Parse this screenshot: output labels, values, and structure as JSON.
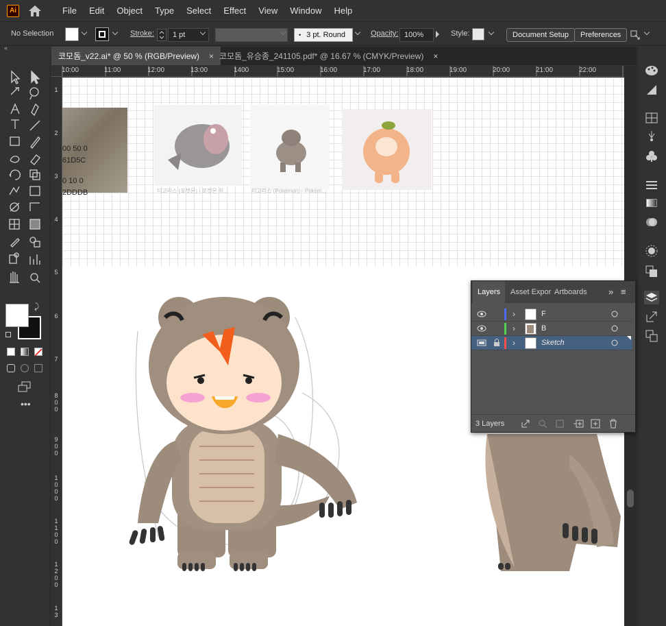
{
  "app": {
    "logo": "Ai",
    "menu": [
      "File",
      "Edit",
      "Object",
      "Type",
      "Select",
      "Effect",
      "View",
      "Window",
      "Help"
    ]
  },
  "control_bar": {
    "selection": "No Selection",
    "stroke_label": "Stroke:",
    "stroke_value": "1 pt",
    "brush_value": "3 pt. Round",
    "opacity_label": "Opacity:",
    "opacity_value": "100%",
    "style_label": "Style:",
    "document_setup": "Document Setup",
    "preferences": "Preferences"
  },
  "tabs": [
    {
      "label": "코모돔_v22.ai* @ 50 % (RGB/Preview)",
      "close": "×"
    },
    {
      "label": "코모돔_유승종_241105.pdf* @ 16.67 % (CMYK/Preview)",
      "close": "×"
    }
  ],
  "ruler": {
    "h": [
      "10:00",
      "11:00",
      "12:00",
      "13:00",
      "1400",
      "15:00",
      "16:00",
      "17:00",
      "18:00",
      "19:00",
      "20:00",
      "21:00",
      "22:00"
    ],
    "v": [
      "1",
      "2",
      "3",
      "4",
      "5",
      "6",
      "7",
      "8\n0\n0",
      "9\n0\n0",
      "1\n0\n0\n0",
      "1\n1\n0\n0",
      "1\n2\n0\n0",
      "1\n3"
    ]
  },
  "canvas": {
    "color_note_1": "00 50 0",
    "color_note_2": "61D5C",
    "color_note_3": "0 10 0",
    "color_note_4": "2DDDB",
    "caption_1": "티고리스 (포켓몬) | 포켓몬 위...",
    "caption_2": "티고리스 (Pokémon) - Pokém..."
  },
  "layers_panel": {
    "tabs": [
      "Layers",
      "Asset Expor",
      "Artboards"
    ],
    "layers": [
      {
        "name": "F",
        "color": "#4d6bff"
      },
      {
        "name": "B",
        "color": "#4fd34f"
      },
      {
        "name": "Sketch",
        "color": "#ff4d4d"
      }
    ],
    "count": "3 Layers"
  },
  "colors": {
    "ui_bg": "#323232",
    "accent_selected": "#46607f",
    "brand": "#ff9a00"
  }
}
